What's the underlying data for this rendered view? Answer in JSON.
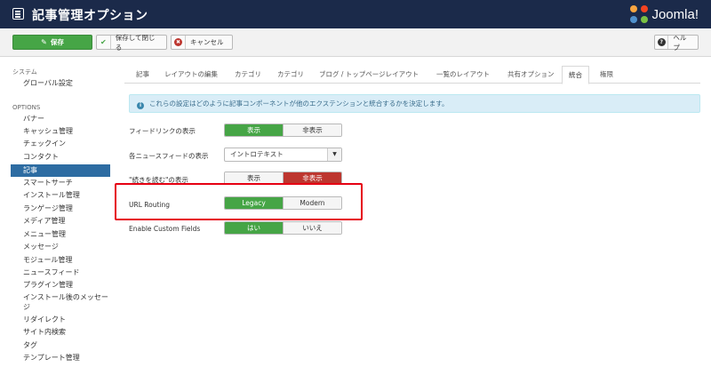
{
  "header": {
    "title": "記事管理オプション",
    "logo_text": "Joomla!"
  },
  "toolbar": {
    "save_label": "保存",
    "save_close_label": "保存して閉じる",
    "cancel_label": "キャンセル",
    "help_label": "ヘルプ"
  },
  "sidebar": {
    "system_header": "システム",
    "global_settings": "グローバル設定",
    "options_header": "OPTIONS",
    "items": [
      "バナー",
      "キャッシュ管理",
      "チェックイン",
      "コンタクト",
      "記事",
      "スマートサーチ",
      "インストール管理",
      "ランゲージ管理",
      "メディア管理",
      "メニュー管理",
      "メッセージ",
      "モジュール管理",
      "ニュースフィード",
      "プラグイン管理",
      "インストール後のメッセージ",
      "リダイレクト",
      "サイト内検索",
      "タグ",
      "テンプレート管理"
    ],
    "active_item": "記事"
  },
  "tabs": [
    "記事",
    "レイアウトの編集",
    "カテゴリ",
    "カテゴリ",
    "ブログ / トップページレイアウト",
    "一覧のレイアウト",
    "共有オプション",
    "統合",
    "権限"
  ],
  "active_tab": "統合",
  "alert": {
    "text": "これらの設定はどのように記事コンポーネントが他のエクステンションと統合するかを決定します。"
  },
  "form": {
    "feed_link": {
      "label": "フィードリンクの表示",
      "on": "表示",
      "off": "非表示",
      "selected": "on"
    },
    "each_feed": {
      "label": "各ニュースフィードの表示",
      "value": "イントロテキスト"
    },
    "read_more": {
      "label": "\"続きを読む\"の表示",
      "on": "表示",
      "off": "非表示",
      "selected": "off"
    },
    "url_routing": {
      "label": "URL Routing",
      "on": "Legacy",
      "off": "Modern",
      "selected": "on"
    },
    "custom_fields": {
      "label": "Enable Custom Fields",
      "on": "はい",
      "off": "いいえ",
      "selected": "on"
    }
  },
  "colors": {
    "header_bg": "#1b2a4a",
    "green": "#46a546",
    "red": "#bd362f",
    "active_sidebar": "#2d6ca2",
    "highlight": "#e60012"
  }
}
